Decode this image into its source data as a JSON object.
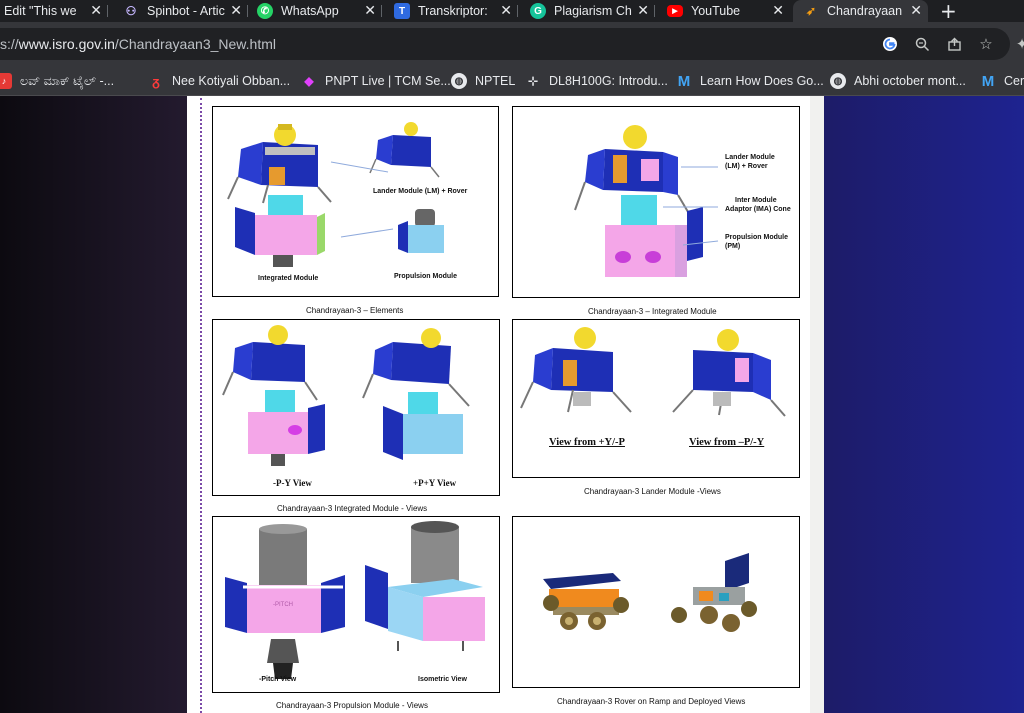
{
  "tabs": [
    {
      "title": "Edit \"This wee",
      "icon": "edit-icon",
      "active": false
    },
    {
      "title": "Spinbot - Artic",
      "icon": "spinbot-icon",
      "active": false
    },
    {
      "title": "WhatsApp",
      "icon": "whatsapp-icon",
      "active": false
    },
    {
      "title": "Transkriptor: ",
      "icon": "transkriptor-icon",
      "active": false
    },
    {
      "title": "Plagiarism Ch",
      "icon": "grammarly-icon",
      "active": false
    },
    {
      "title": "YouTube",
      "icon": "youtube-icon",
      "active": false
    },
    {
      "title": "Chandrayaan",
      "icon": "isro-icon",
      "active": true
    }
  ],
  "address_bar": {
    "url_prefix": "s://",
    "url_host": "www.isro.gov.in",
    "url_path": "/Chandrayaan3_New.html"
  },
  "bookmarks": [
    {
      "label": "ಲವ್ ಮಾಕ್ ಟೈಲ್ -...",
      "icon": "music-icon"
    },
    {
      "label": "Nee Kotiyali Obban...",
      "icon": "saavn-icon"
    },
    {
      "label": "PNPT Live | TCM Se...",
      "icon": "tcm-icon"
    },
    {
      "label": "NPTEL",
      "icon": "globe-icon"
    },
    {
      "label": "DL8H100G: Introdu...",
      "icon": "drone-icon"
    },
    {
      "label": "Learn How Does Go...",
      "icon": "medium-icon"
    },
    {
      "label": "Abhi october mont...",
      "icon": "globe-icon"
    },
    {
      "label": "Cert",
      "icon": "medium-icon"
    }
  ],
  "figures": {
    "elements": {
      "caption": "Chandrayaan-3 – Elements",
      "labels": {
        "lm": "Lander Module (LM) + Rover",
        "integrated": "Integrated Module",
        "propulsion": "Propulsion Module"
      }
    },
    "integrated": {
      "caption": "Chandrayaan-3 – Integrated Module",
      "labels": {
        "lm_line1": "Lander Module",
        "lm_line2": "(LM) + Rover",
        "ima_line1": "Inter Module",
        "ima_line2": "Adaptor (IMA) Cone",
        "pm_line1": "Propulsion Module",
        "pm_line2": "(PM)"
      }
    },
    "integrated_views": {
      "caption": "Chandrayaan-3 Integrated Module - Views",
      "labels": {
        "left": "-P-Y View",
        "right": "+P+Y View"
      }
    },
    "lander_views": {
      "caption": "Chandrayaan-3 Lander Module -Views",
      "labels": {
        "left": "View from +Y/-P",
        "right": "View from –P/-Y"
      }
    },
    "propulsion_views": {
      "caption": "Chandrayaan-3 Propulsion Module - Views",
      "labels": {
        "left": "-Pitch View",
        "right": "Isometric View",
        "pitch": "-PITCH"
      }
    },
    "rover": {
      "caption": "Chandrayaan-3 Rover on Ramp and Deployed Views"
    }
  }
}
